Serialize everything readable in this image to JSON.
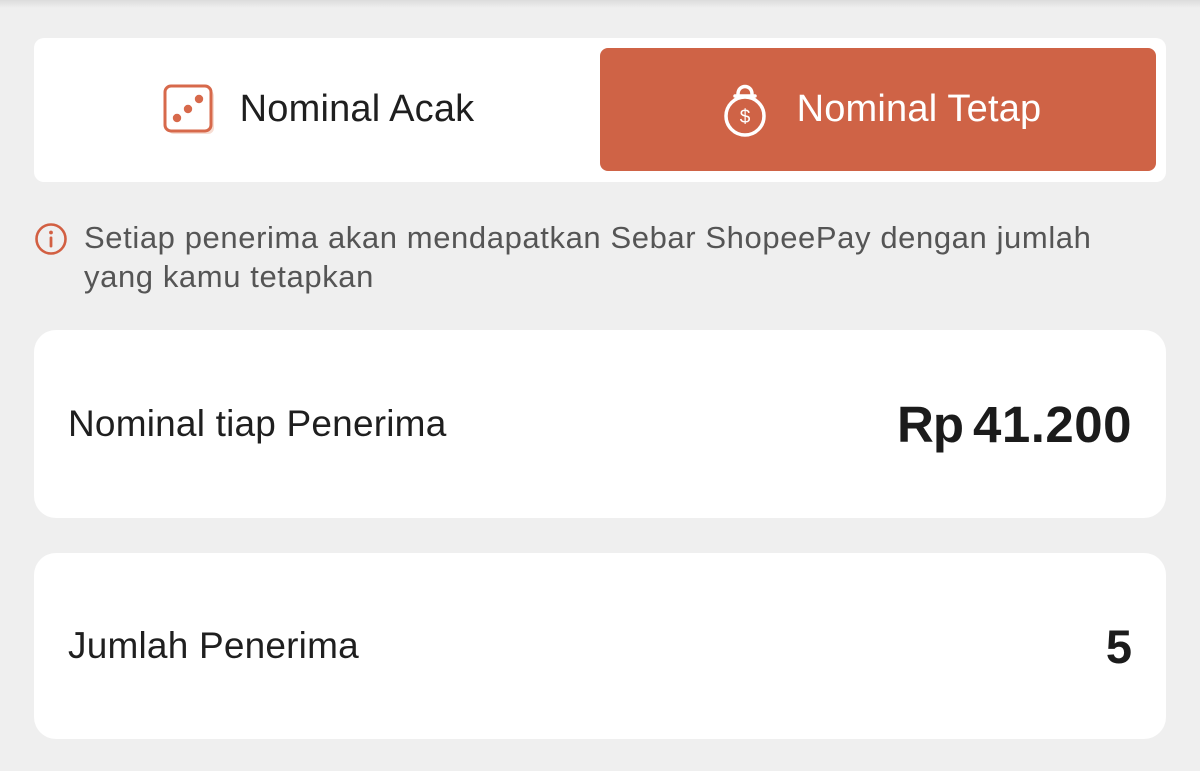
{
  "mode_tabs": {
    "random": {
      "label": "Nominal Acak",
      "icon": "dice-icon",
      "selected": false
    },
    "fixed": {
      "label": "Nominal Tetap",
      "icon": "money-bag-icon",
      "selected": true
    }
  },
  "info": {
    "icon": "info-icon",
    "text": "Setiap penerima akan mendapatkan Sebar ShopeePay dengan jumlah yang kamu tetapkan"
  },
  "amount_row": {
    "label": "Nominal tiap Penerima",
    "currency": "Rp",
    "value": "41.200"
  },
  "count_row": {
    "label": "Jumlah Penerima",
    "value": "5"
  },
  "colors": {
    "accent": "#cf6346",
    "background": "#efefef",
    "card": "#ffffff",
    "text": "#1f1f1f",
    "muted_text": "#555555"
  }
}
